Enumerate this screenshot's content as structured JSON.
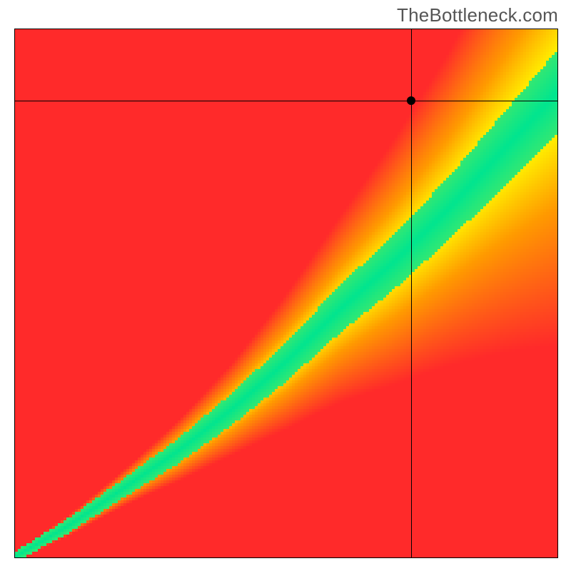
{
  "watermark": "TheBottleneck.com",
  "chart_data": {
    "type": "heatmap",
    "title": "",
    "xlabel": "",
    "ylabel": "",
    "xlim": [
      0,
      1
    ],
    "ylim": [
      0,
      1
    ],
    "marker": {
      "x": 0.73,
      "y": 0.865
    },
    "ridge": {
      "description": "Green compatibility band center (y as function of x), normalized 0–1",
      "points": [
        {
          "x": 0.0,
          "y": 0.0
        },
        {
          "x": 0.1,
          "y": 0.06
        },
        {
          "x": 0.2,
          "y": 0.13
        },
        {
          "x": 0.3,
          "y": 0.2
        },
        {
          "x": 0.4,
          "y": 0.28
        },
        {
          "x": 0.5,
          "y": 0.37
        },
        {
          "x": 0.6,
          "y": 0.47
        },
        {
          "x": 0.7,
          "y": 0.56
        },
        {
          "x": 0.8,
          "y": 0.66
        },
        {
          "x": 0.9,
          "y": 0.77
        },
        {
          "x": 1.0,
          "y": 0.88
        }
      ]
    },
    "band_halfwidth": {
      "description": "Approx half-width of green band (fraction of axis) at each x",
      "points": [
        {
          "x": 0.0,
          "w": 0.01
        },
        {
          "x": 0.2,
          "w": 0.018
        },
        {
          "x": 0.4,
          "w": 0.03
        },
        {
          "x": 0.6,
          "w": 0.045
        },
        {
          "x": 0.8,
          "w": 0.06
        },
        {
          "x": 1.0,
          "w": 0.08
        }
      ]
    },
    "palette": {
      "green": "#00e58f",
      "yellow": "#fff200",
      "orange": "#ff9a00",
      "red": "#ff2a2a"
    }
  }
}
